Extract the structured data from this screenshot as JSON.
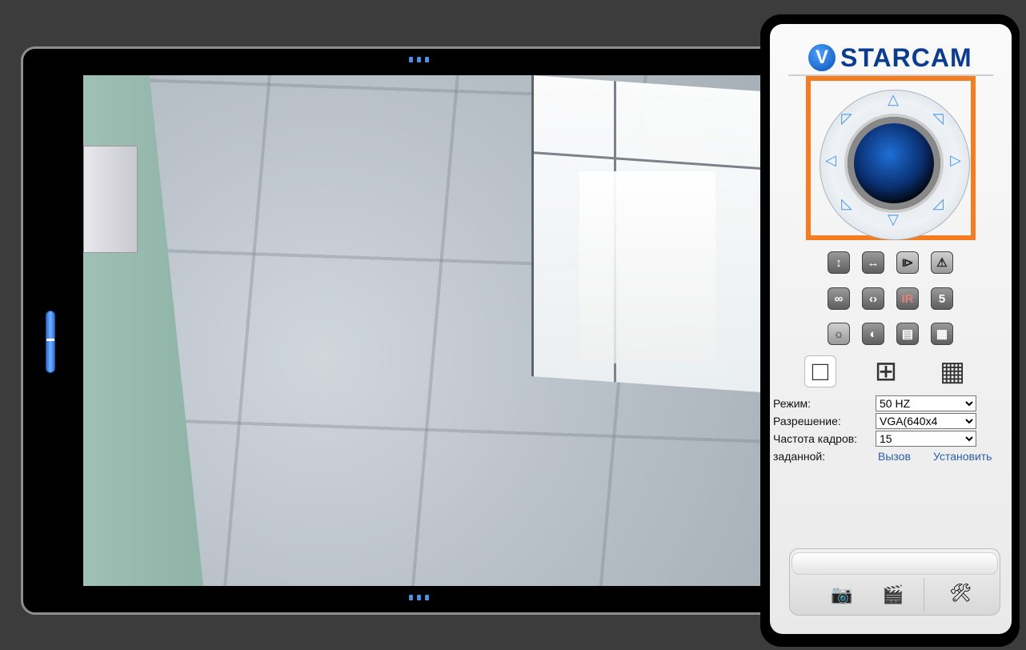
{
  "brand": {
    "mark": "V",
    "name": "STARCAM"
  },
  "viewer": {
    "feed": "live camera view"
  },
  "ptz": {
    "up": "△",
    "down": "▽",
    "left": "◁",
    "right": "▷",
    "up_left": "◸",
    "up_right": "◹",
    "down_left": "◺",
    "down_right": "◿"
  },
  "tools": {
    "flip_vertical": "↕",
    "flip_horizontal": "↔",
    "mirror": "⧐",
    "flip": "⚠",
    "cruise_vertical": "∞",
    "cruise_horizontal": "‹›",
    "ir": "IR",
    "speed": "5",
    "brightness": "☼",
    "contrast": "◐",
    "saturation": "▤",
    "color": "▦"
  },
  "layouts": {
    "single": "□",
    "quad": "⊞",
    "nine": "▦"
  },
  "settings": {
    "mode_label": "Режим:",
    "mode_value": "50 HZ",
    "resolution_label": "Разрешение:",
    "resolution_value": "VGA(640x4",
    "framerate_label": "Частота кадров:",
    "framerate_value": "15",
    "preset_label": "заданной:",
    "call_link": "Вызов",
    "set_link": "Установить"
  },
  "bottom": {
    "snapshot": "📷",
    "record": "🎬",
    "settings": "🛠"
  },
  "colors": {
    "highlight": "#f57c20",
    "link": "#2a5fa8",
    "brand": "#0b3c8f"
  }
}
